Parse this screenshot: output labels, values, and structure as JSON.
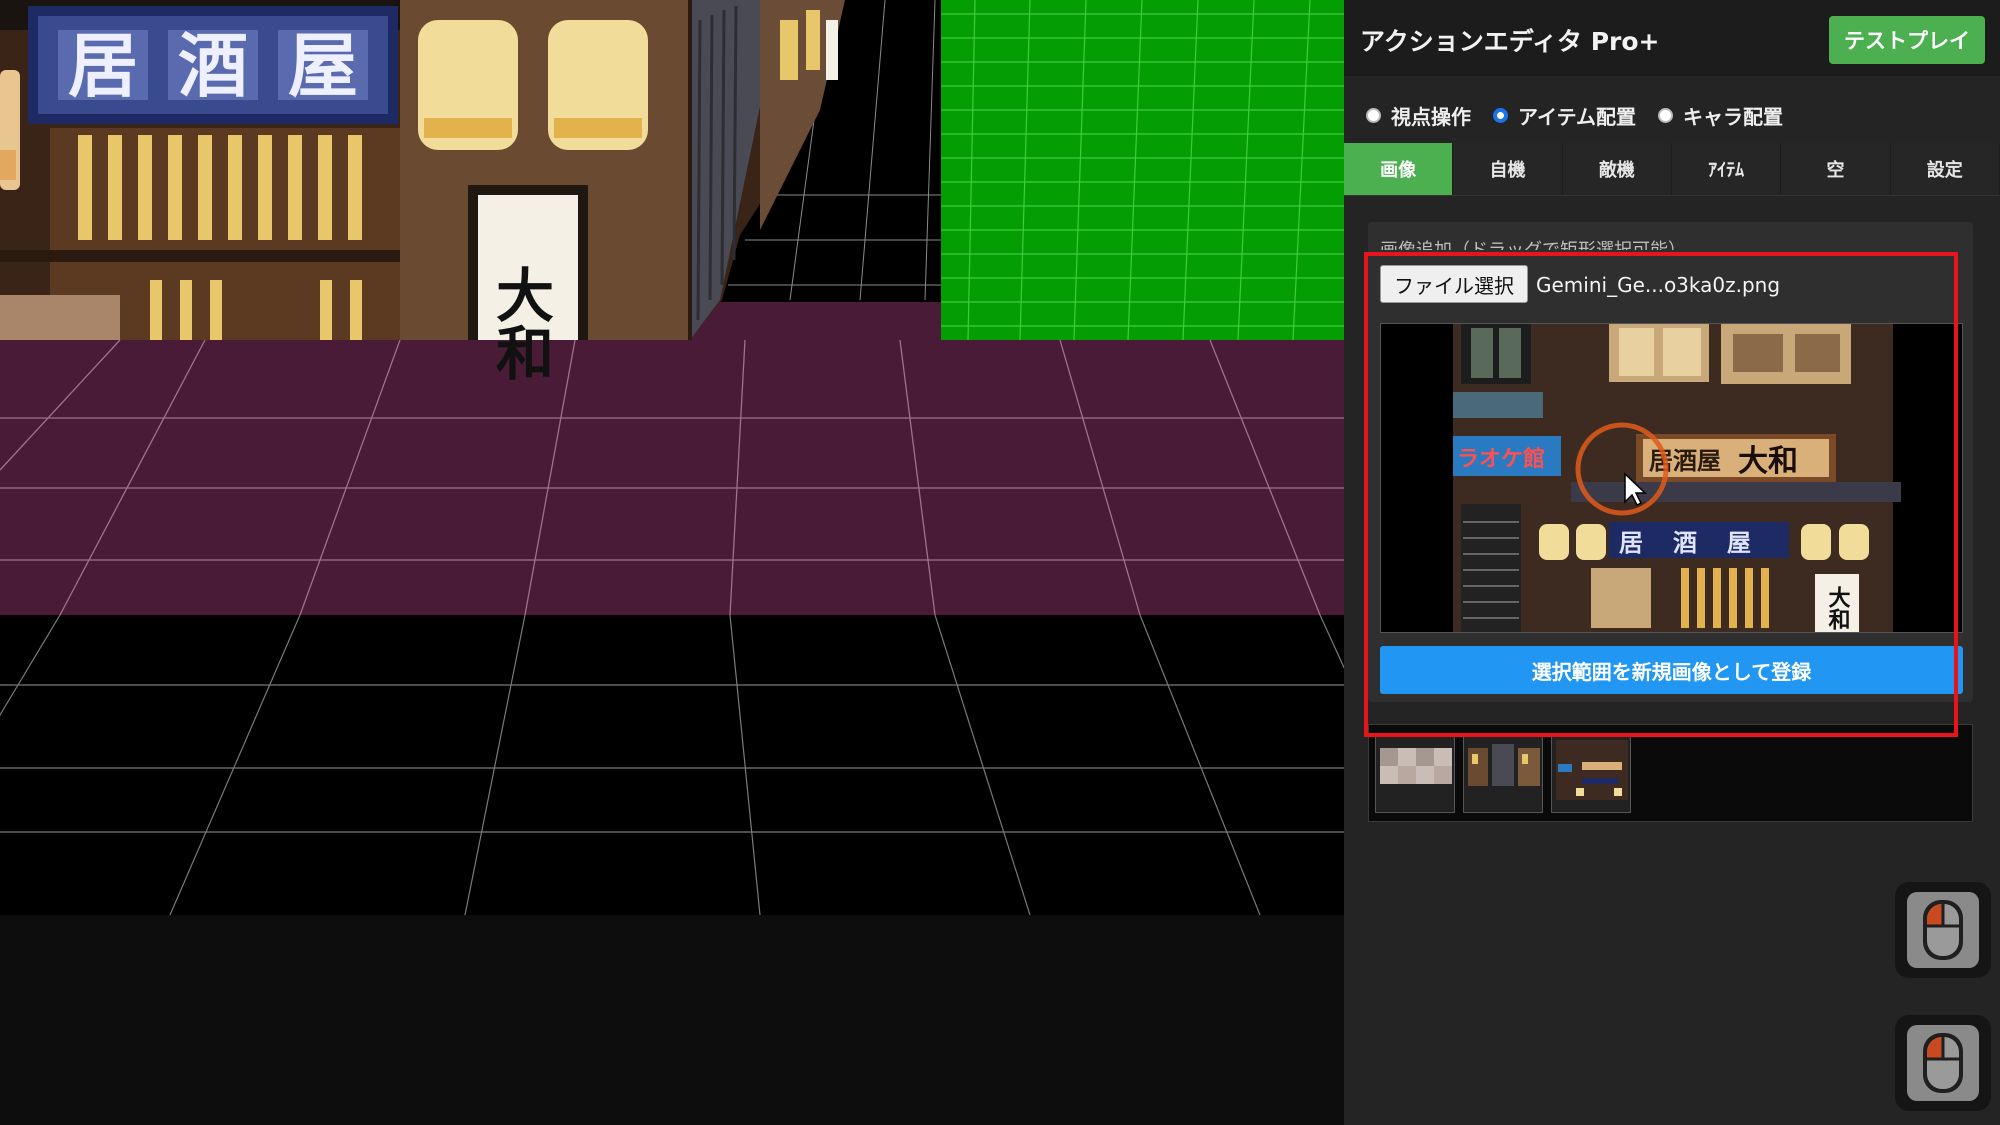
{
  "panel": {
    "title": "アクションエディタ Pro+",
    "test_play_label": "テストプレイ",
    "modes": [
      {
        "label": "視点操作",
        "selected": false
      },
      {
        "label": "アイテム配置",
        "selected": true
      },
      {
        "label": "キャラ配置",
        "selected": false
      }
    ],
    "tabs": [
      {
        "label": "画像",
        "active": true
      },
      {
        "label": "自機",
        "active": false
      },
      {
        "label": "敵機",
        "active": false
      },
      {
        "label": "ｱｲﾃﾑ",
        "active": false
      },
      {
        "label": "空",
        "active": false
      },
      {
        "label": "設定",
        "active": false
      }
    ]
  },
  "image_section": {
    "label": "画像追加（ドラッグで矩形選択可能）",
    "file_button_label": "ファイル選択",
    "file_name": "Gemini_Ge...o3ka0z.png",
    "register_button_label": "選択範囲を新規画像として登録",
    "thumbnails": [
      "tile-thumbnail",
      "building-thumbnail",
      "storefront-thumbnail"
    ]
  },
  "preview_signs": {
    "karaoke": "ラオケ館",
    "izakaya_sign": "居酒屋",
    "yamato": "大和",
    "izakaya_banner": [
      "居",
      "酒",
      "屋"
    ],
    "lantern_text": "大和"
  },
  "viewport_signs": {
    "banner": [
      "居",
      "酒",
      "屋"
    ],
    "lantern": "大和"
  },
  "colors": {
    "accent_green": "#4caf50",
    "accent_blue": "#2196f3",
    "highlight_red": "#e8141b",
    "floor_purple": "#4a1b37",
    "wall_green": "#049e04"
  }
}
